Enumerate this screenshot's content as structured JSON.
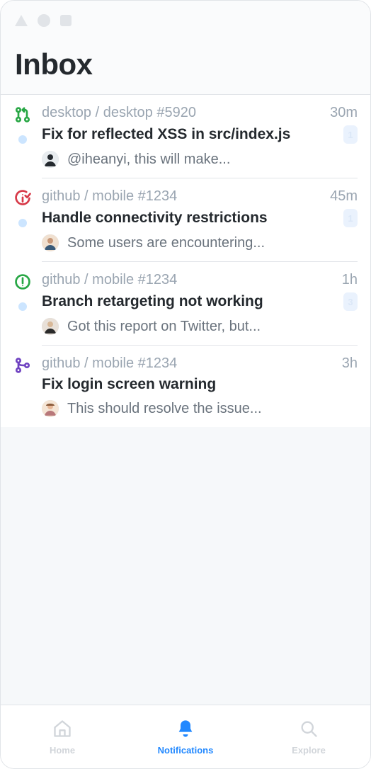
{
  "header": {
    "title": "Inbox"
  },
  "items": [
    {
      "icon": "pr-open",
      "unread": true,
      "repo": "desktop / desktop #5920",
      "time": "30m",
      "title": "Fix for reflected XSS in src/index.js",
      "badge": "1",
      "preview": "@iheanyi, this will make..."
    },
    {
      "icon": "issue-closed",
      "unread": true,
      "repo": "github / mobile #1234",
      "time": "45m",
      "title": "Handle connectivity restrictions",
      "badge": "1",
      "preview": "Some users are encountering..."
    },
    {
      "icon": "issue-open",
      "unread": true,
      "repo": "github / mobile #1234",
      "time": "1h",
      "title": "Branch retargeting not working",
      "badge": "3",
      "preview": "Got this report on Twitter, but..."
    },
    {
      "icon": "pr-merged",
      "unread": false,
      "repo": "github / mobile #1234",
      "time": "3h",
      "title": "Fix login screen warning",
      "badge": "",
      "preview": "This should resolve the issue..."
    }
  ],
  "tabs": {
    "home": "Home",
    "notifications": "Notifications",
    "explore": "Explore"
  }
}
